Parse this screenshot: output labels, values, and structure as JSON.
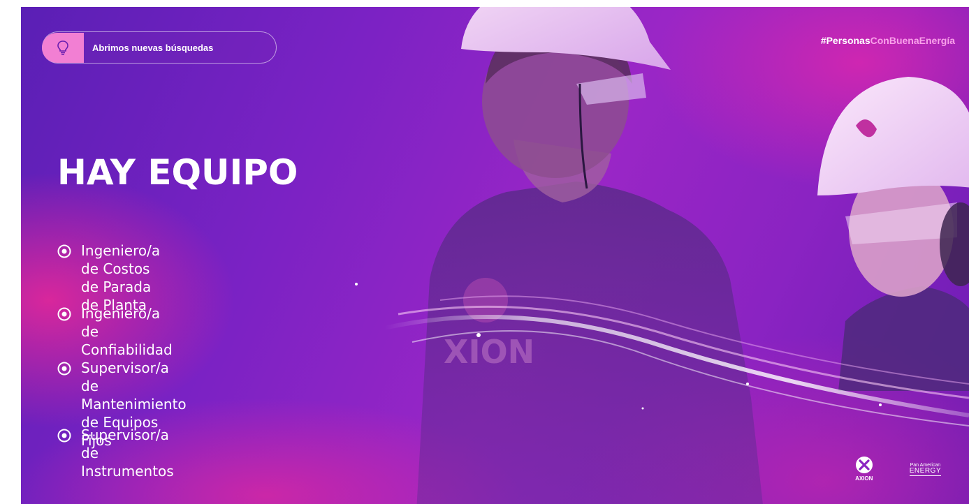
{
  "banner": {
    "pill": {
      "icon": "lightbulb-icon",
      "label": "Abrimos nuevas búsquedas",
      "accent_color": "#f27fd3"
    },
    "hashtag": {
      "part1": "#Personas",
      "part2": "ConBuenaEnergía",
      "part1_color": "#ffffff",
      "part2_color": "#f9a0ea"
    },
    "title": "HAY EQUIPO",
    "roles": [
      {
        "text": "Ingeniero/a de Costos\nde Parada de Planta"
      },
      {
        "text": "Ingeniero/a de Confiabilidad"
      },
      {
        "text": "Supervisor/a de Mantenimiento\nde Equipos Fijos"
      },
      {
        "text": "Supervisor/a de Instrumentos"
      }
    ],
    "bullet_icon": "target-circle-icon",
    "logos": {
      "axion": "AXION",
      "pan_american_top": "Pan American",
      "pan_american_bottom": "ENERGY"
    }
  }
}
